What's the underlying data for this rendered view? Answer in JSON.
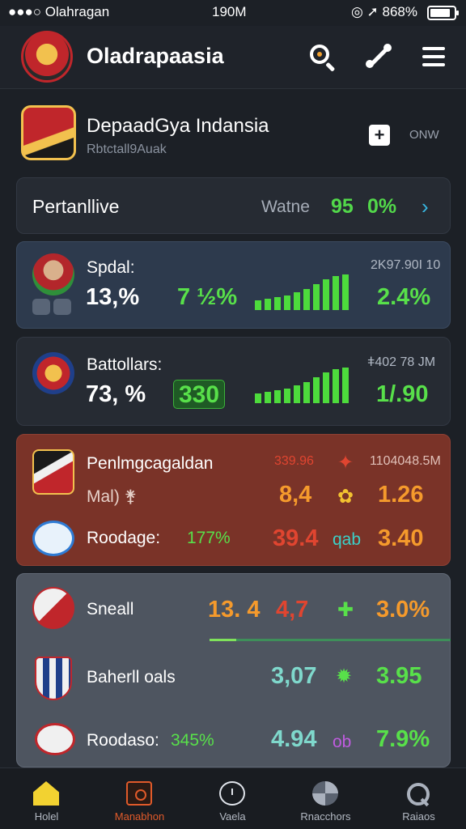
{
  "status_bar": {
    "carrier": "●●●○ Olahragan",
    "time": "190M",
    "battery": "◎ ➚ 868%"
  },
  "header": {
    "title": "Oladrapaasia"
  },
  "team": {
    "name": "DepaadGya Indansia",
    "subtitle": "Rbtctall9Auak",
    "tag": "ONW"
  },
  "performance": {
    "label": "Pertanllive",
    "watch_label": "Watne",
    "value1": "95",
    "value2": "0%"
  },
  "cards": [
    {
      "name": "Spdal:",
      "percent": "13,%",
      "change": "7 ½%",
      "meta": "2K97.90I 10",
      "value": "2.4%"
    },
    {
      "name": "Battollars:",
      "percent": "73, %",
      "change": "330",
      "meta": "ǂ402 78 JM",
      "value": "1/.90"
    }
  ],
  "red_card": {
    "row1": {
      "name": "Penlmgcagaldan",
      "red_value": "339.96",
      "meta": "1104048.5M"
    },
    "row2": {
      "name": "Mal) ⚵",
      "orange_value": "8,4",
      "value": "1.26"
    },
    "row3": {
      "name": "Roodage:",
      "green_pct": "177%",
      "red_value": "39.4",
      "tag": "qab",
      "value": "3.40"
    }
  },
  "gray_card": {
    "row1": {
      "name": "Sneall",
      "orange_value": "13. 4",
      "red_value": "4,7",
      "value": "3.0%"
    },
    "row2": {
      "name": "Baherll oals",
      "teal_value": "3,07",
      "value": "3.95"
    },
    "row3": {
      "name": "Roodaso:",
      "green_pct": "345%",
      "teal_value": "4.94",
      "tag": "ob",
      "value": "7.9%"
    }
  },
  "nav": [
    {
      "label": "Holel",
      "icon": "home-icon",
      "color": "#f2d231"
    },
    {
      "label": "Manabhon",
      "icon": "market-icon",
      "color": "#e05a2a"
    },
    {
      "label": "Vaela",
      "icon": "watch-icon"
    },
    {
      "label": "Rnacchors",
      "icon": "stats-icon"
    },
    {
      "label": "Raiaos",
      "icon": "search-icon"
    }
  ],
  "colors": {
    "accent_green": "#58e04a",
    "accent_orange": "#f59a2c",
    "accent_red": "#e04530",
    "nav_active": "#e05a2a"
  }
}
